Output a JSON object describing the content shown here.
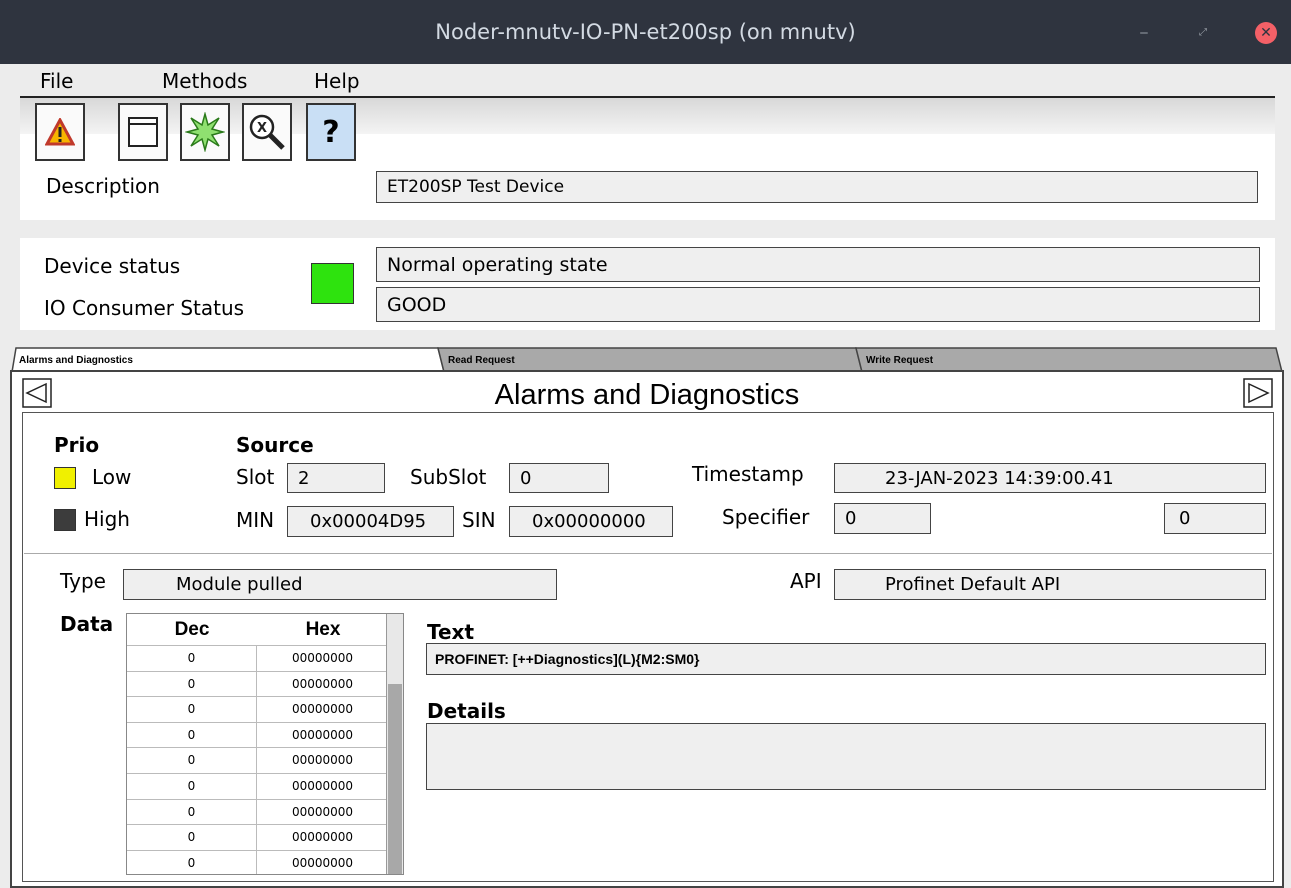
{
  "window": {
    "title": "Noder-mnutv-IO-PN-et200sp (on mnutv)"
  },
  "menu": {
    "items": [
      "File",
      "Methods",
      "Help"
    ]
  },
  "toolbar": {
    "help_label": "?"
  },
  "device": {
    "description_label": "Description",
    "description_value": "ET200SP Test Device",
    "status_label": "Device status",
    "status_value": "Normal operating state",
    "consumer_label": "IO Consumer Status",
    "consumer_value": "GOOD",
    "status_color": "#2ee30e"
  },
  "tabs": [
    "Alarms and Diagnostics",
    "Read Request",
    "Write Request"
  ],
  "alarm": {
    "heading": "Alarms and Diagnostics",
    "prio_label": "Prio",
    "low_label": "Low",
    "high_label": "High",
    "low_color": "#f0f000",
    "high_color": "#3c3c3c",
    "source_label": "Source",
    "slot_label": "Slot",
    "slot_value": "2",
    "subslot_label": "SubSlot",
    "subslot_value": "0",
    "timestamp_label": "Timestamp",
    "timestamp_value": "23-JAN-2023 14:39:00.41",
    "min_label": "MIN",
    "min_value": "0x00004D95",
    "sin_label": "SIN",
    "sin_value": "0x00000000",
    "specifier_label": "Specifier",
    "specifier_value": "0",
    "specifier_extra": "0",
    "type_label": "Type",
    "type_value": "Module pulled",
    "api_label": "API",
    "api_value": "Profinet Default API",
    "data_label": "Data",
    "dec_header": "Dec",
    "hex_header": "Hex",
    "data_rows": [
      [
        "0",
        "00000000"
      ],
      [
        "0",
        "00000000"
      ],
      [
        "0",
        "00000000"
      ],
      [
        "0",
        "00000000"
      ],
      [
        "0",
        "00000000"
      ],
      [
        "0",
        "00000000"
      ],
      [
        "0",
        "00000000"
      ],
      [
        "0",
        "00000000"
      ],
      [
        "0",
        "00000000"
      ]
    ],
    "text_label": "Text",
    "text_value": "PROFINET: [++Diagnostics](L){M2:SM0}",
    "details_label": "Details",
    "details_value": ""
  }
}
